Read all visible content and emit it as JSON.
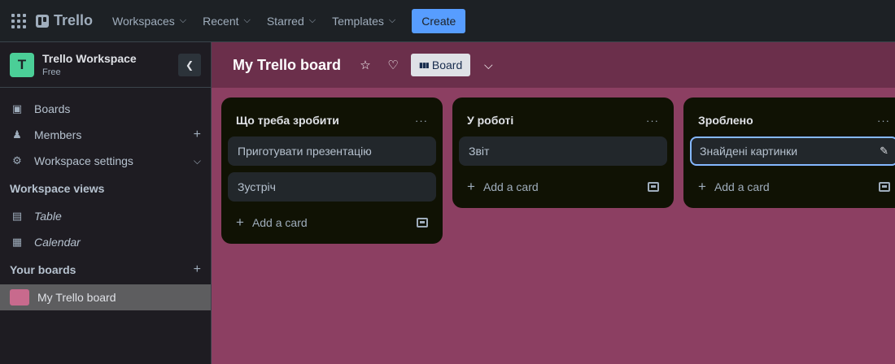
{
  "topbar": {
    "logo": "Trello",
    "nav": [
      {
        "label": "Workspaces"
      },
      {
        "label": "Recent"
      },
      {
        "label": "Starred"
      },
      {
        "label": "Templates"
      }
    ],
    "create_label": "Create"
  },
  "sidebar": {
    "workspace_initial": "T",
    "workspace_name": "Trello Workspace",
    "workspace_plan": "Free",
    "items": [
      {
        "label": "Boards"
      },
      {
        "label": "Members"
      },
      {
        "label": "Workspace settings"
      }
    ],
    "views_heading": "Workspace views",
    "views": [
      {
        "label": "Table"
      },
      {
        "label": "Calendar"
      }
    ],
    "your_boards_heading": "Your boards",
    "boards": [
      {
        "label": "My Trello board",
        "color": "#c86a8d"
      }
    ]
  },
  "board": {
    "title": "My Trello board",
    "view_label": "Board",
    "background": "#8c3f62",
    "lists": [
      {
        "title": "Що треба зробити",
        "cards": [
          "Приготувати презентацію",
          "Зустріч"
        ],
        "add_label": "Add a card"
      },
      {
        "title": "У роботі",
        "cards": [
          "Звіт"
        ],
        "add_label": "Add a card"
      },
      {
        "title": "Зроблено",
        "cards": [
          "Знайдені картинки"
        ],
        "add_label": "Add a card"
      }
    ]
  },
  "colors": {
    "accent": "#579dff",
    "workspace_avatar": "#4bce97",
    "board_header": "#6b2f4b"
  }
}
